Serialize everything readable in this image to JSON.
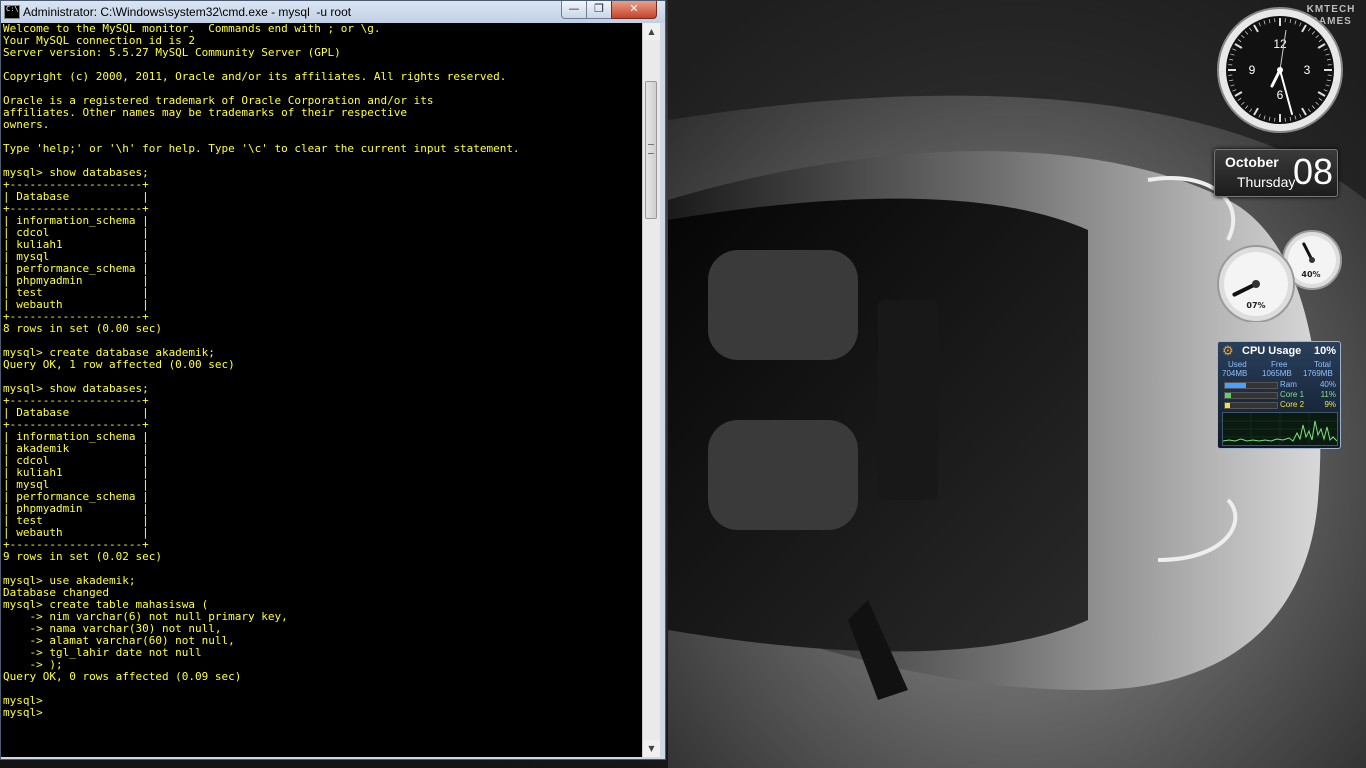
{
  "window": {
    "title": "Administrator: C:\\Windows\\system32\\cmd.exe - mysql  -u root",
    "icon_label": "C:\\",
    "buttons": {
      "minimize": "—",
      "maximize": "❐",
      "close": "✕"
    }
  },
  "console": {
    "lines": [
      "Welcome to the MySQL monitor.  Commands end with ; or \\g.",
      "Your MySQL connection id is 2",
      "Server version: 5.5.27 MySQL Community Server (GPL)",
      "",
      "Copyright (c) 2000, 2011, Oracle and/or its affiliates. All rights reserved.",
      "",
      "Oracle is a registered trademark of Oracle Corporation and/or its",
      "affiliates. Other names may be trademarks of their respective",
      "owners.",
      "",
      "Type 'help;' or '\\h' for help. Type '\\c' to clear the current input statement.",
      "",
      "mysql> show databases;",
      "+--------------------+",
      "| Database           |",
      "+--------------------+",
      "| information_schema |",
      "| cdcol              |",
      "| kuliah1            |",
      "| mysql              |",
      "| performance_schema |",
      "| phpmyadmin         |",
      "| test               |",
      "| webauth            |",
      "+--------------------+",
      "8 rows in set (0.00 sec)",
      "",
      "mysql> create database akademik;",
      "Query OK, 1 row affected (0.00 sec)",
      "",
      "mysql> show databases;",
      "+--------------------+",
      "| Database           |",
      "+--------------------+",
      "| information_schema |",
      "| akademik           |",
      "| cdcol              |",
      "| kuliah1            |",
      "| mysql              |",
      "| performance_schema |",
      "| phpmyadmin         |",
      "| test               |",
      "| webauth            |",
      "+--------------------+",
      "9 rows in set (0.02 sec)",
      "",
      "mysql> use akademik;",
      "Database changed",
      "mysql> create table mahasiswa (",
      "    -> nim varchar(6) not null primary key,",
      "    -> nama varchar(30) not null,",
      "    -> alamat varchar(60) not null,",
      "    -> tgl_lahir date not null",
      "    -> );",
      "Query OK, 0 rows affected (0.09 sec)",
      "",
      "mysql>",
      "mysql>"
    ]
  },
  "scrollbar": {
    "up": "▲",
    "down": "▼"
  },
  "desktop": {
    "logo_text": "KMTECH\nGAMES",
    "clock": {
      "numerals": [
        "12",
        "3",
        "6",
        "9"
      ]
    },
    "calendar": {
      "month": "October",
      "weekday": "Thursday",
      "day": "08"
    },
    "meters": {
      "big_label": "07%",
      "small_label": "40%",
      "big_value": 0.07,
      "small_value": 0.4
    },
    "cpu": {
      "title": "CPU Usage",
      "total": "10%",
      "headers": [
        "Used",
        "Free",
        "Total"
      ],
      "values": [
        "704MB",
        "1065MB",
        "1769MB"
      ],
      "rows": [
        {
          "label": "Ram",
          "pct": "40%",
          "value": 0.4,
          "color": "#4aa0ff"
        },
        {
          "label": "Core 1",
          "pct": "11%",
          "value": 0.11,
          "color": "#5fd35f"
        },
        {
          "label": "Core 2",
          "pct": "9%",
          "value": 0.09,
          "color": "#f0e040"
        }
      ],
      "label_colors": {
        "Ram": "#8fc0ff",
        "Core 1": "#8fd88f",
        "Core 2": "#f0e040"
      }
    }
  }
}
